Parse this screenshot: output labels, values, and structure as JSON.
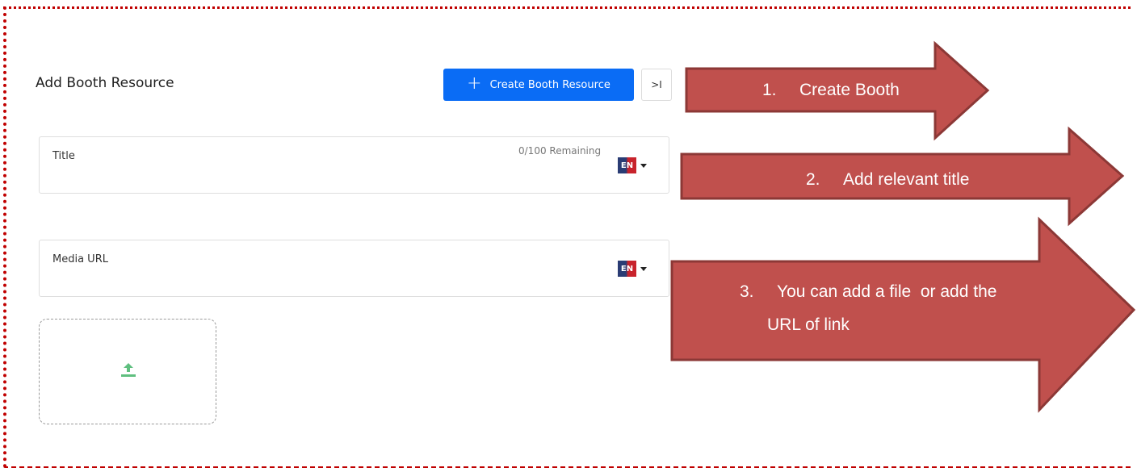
{
  "panel": {
    "title": "Add Booth Resource",
    "create_button_label": "Create Booth Resource",
    "collapse_button_label": ">I"
  },
  "title_field": {
    "label": "Title",
    "remaining": "0/100 Remaining",
    "language": "EN"
  },
  "media_field": {
    "label": "Media URL",
    "language": "EN"
  },
  "upload": {
    "icon": "upload-icon"
  },
  "annotations": [
    {
      "number": "1.",
      "text": "Create Booth"
    },
    {
      "number": "2.",
      "text": "Add relevant title"
    },
    {
      "number": "3.",
      "line1": "You can add a file  or add the",
      "line2": "URL of link"
    }
  ],
  "colors": {
    "frame_border": "#c00000",
    "primary_button": "#0a6cf5",
    "annotation_fill": "#c0504d",
    "annotation_border": "#8c3836",
    "upload_icon": "#5fbf7f"
  }
}
